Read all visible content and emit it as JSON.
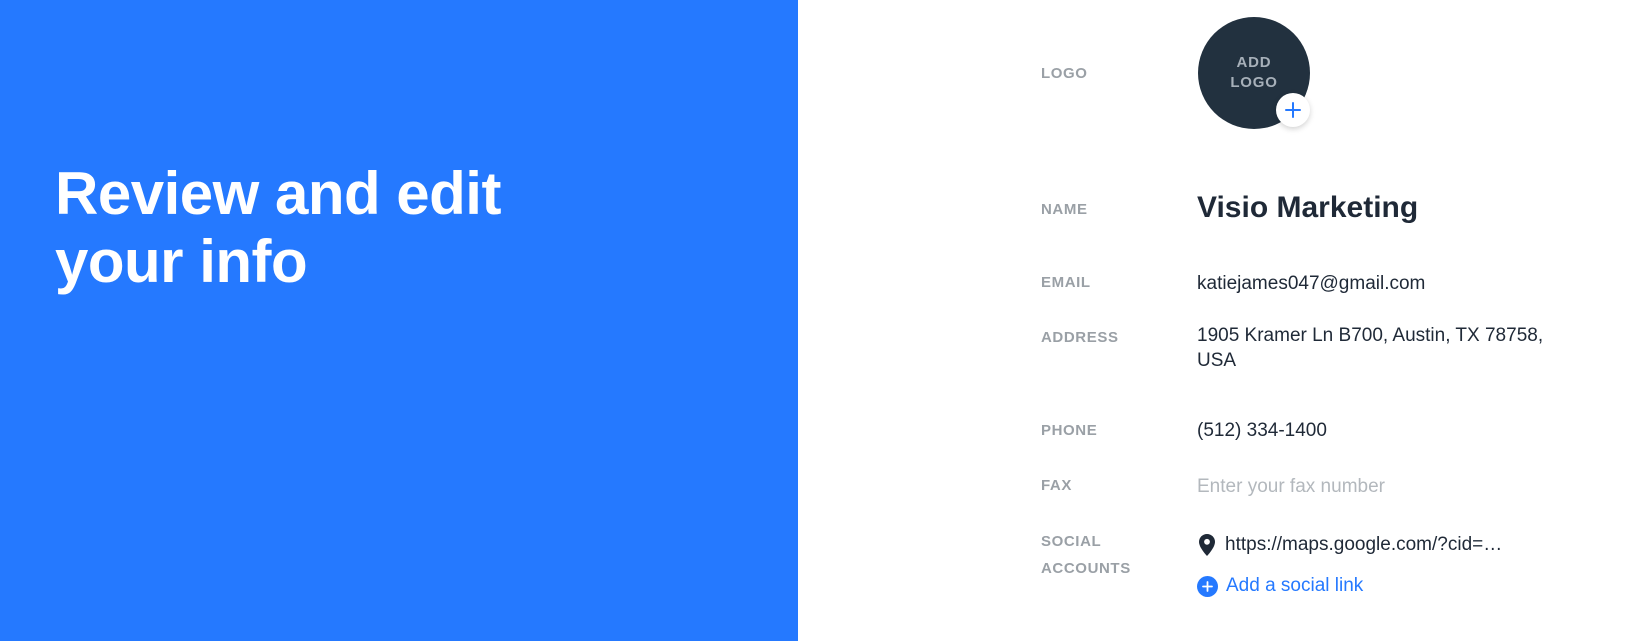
{
  "hero": {
    "title_line1": "Review and edit",
    "title_line2": "your info"
  },
  "colors": {
    "accent": "#2579ff",
    "logo_bg": "#22313f",
    "label": "#9aa0a6",
    "text": "#1f2937",
    "placeholder": "#b3b8bd"
  },
  "form": {
    "logo": {
      "label": "LOGO",
      "placeholder_text": "ADD LOGO",
      "add_icon": "plus-icon"
    },
    "name": {
      "label": "NAME",
      "value": "Visio Marketing"
    },
    "email": {
      "label": "EMAIL",
      "value": "katiejames047@gmail.com"
    },
    "address": {
      "label": "ADDRESS",
      "value": "1905 Kramer Ln B700, Austin, TX 78758, USA"
    },
    "phone": {
      "label": "PHONE",
      "value": "(512) 334-1400"
    },
    "fax": {
      "label": "FAX",
      "value": "",
      "placeholder": "Enter your fax number"
    },
    "social": {
      "label_line1": "SOCIAL",
      "label_line2": "ACCOUNTS",
      "links": [
        {
          "icon": "map-pin-icon",
          "text": "https://maps.google.com/?cid=…"
        }
      ],
      "add_label": "Add a social link",
      "add_icon": "plus-circle-icon"
    }
  }
}
